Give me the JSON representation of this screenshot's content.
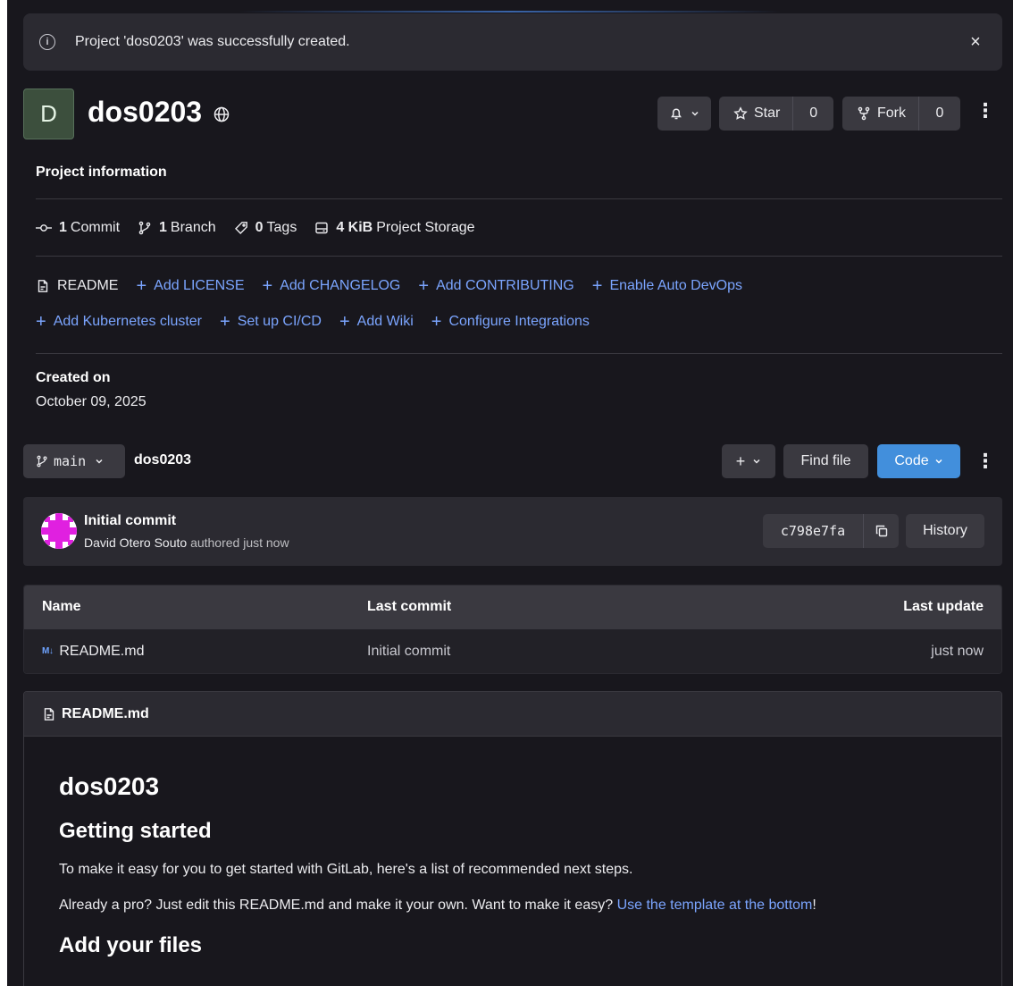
{
  "alert": {
    "message": "Project 'dos0203' was successfully created.",
    "info_icon": "i",
    "close_icon": "×"
  },
  "project": {
    "avatar_letter": "D",
    "name": "dos0203"
  },
  "actions": {
    "notifications_icon": "bell-icon",
    "star_label": "Star",
    "star_count": "0",
    "fork_label": "Fork",
    "fork_count": "0"
  },
  "project_info": {
    "title": "Project information",
    "stats": [
      {
        "count": "1",
        "label": "Commit"
      },
      {
        "count": "1",
        "label": "Branch"
      },
      {
        "count": "0",
        "label": "Tags"
      },
      {
        "count": "4 KiB",
        "label": "Project Storage"
      }
    ],
    "links_row1": [
      {
        "label": "README"
      },
      {
        "label": "Add LICENSE"
      },
      {
        "label": "Add CHANGELOG"
      },
      {
        "label": "Add CONTRIBUTING"
      },
      {
        "label": "Enable Auto DevOps"
      }
    ],
    "links_row2": [
      {
        "label": "Add Kubernetes cluster"
      },
      {
        "label": "Set up CI/CD"
      },
      {
        "label": "Add Wiki"
      },
      {
        "label": "Configure Integrations"
      }
    ],
    "plus_glyph": "+",
    "created_label": "Created on",
    "created_date": "October 09, 2025"
  },
  "toolbar": {
    "branch": "main",
    "breadcrumb": "dos0203",
    "plus_glyph": "+",
    "find_file": "Find file",
    "code": "Code"
  },
  "commit": {
    "title": "Initial commit",
    "author": "David Otero Souto",
    "action": "authored just now",
    "sha": "c798e7fa",
    "history": "History"
  },
  "files": {
    "headers": {
      "name": "Name",
      "last_commit": "Last commit",
      "last_update": "Last update"
    },
    "rows": [
      {
        "icon": "M↓",
        "name": "README.md",
        "last_commit": "Initial commit",
        "last_update": "just now"
      }
    ]
  },
  "readme": {
    "filename": "README.md",
    "h1": "dos0203",
    "h2_1": "Getting started",
    "p1": "To make it easy for you to get started with GitLab, here's a list of recommended next steps.",
    "p2_text": "Already a pro? Just edit this README.md and make it your own. Want to make it easy?",
    "p2_link": "Use the template at the bottom",
    "p2_end": "!",
    "h2_2": "Add your files"
  },
  "colors": {
    "background": "#18171d",
    "surface": "#2b2a31",
    "button": "#3a3940",
    "link": "#7ba5ff",
    "primary": "#428fdc",
    "avatar_bg": "#3c4f3d"
  }
}
